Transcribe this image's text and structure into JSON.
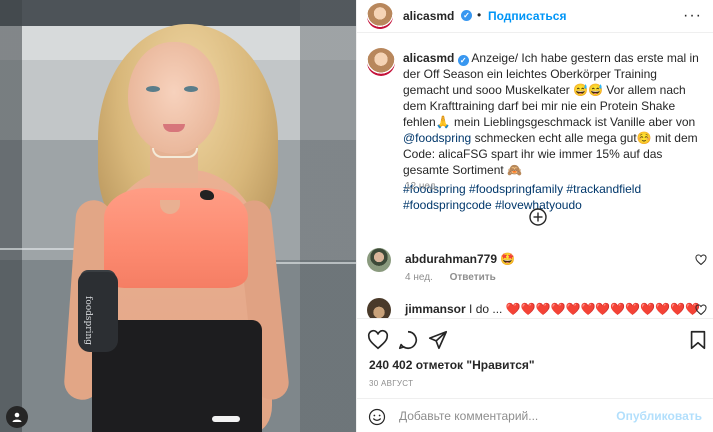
{
  "post": {
    "author": "alicasmd",
    "separator": "•",
    "follow_label": "Подписаться",
    "more_label": "···",
    "caption": {
      "username": "alicasmd",
      "text": "Anzeige/ Ich habe gestern das erste mal in der Off Season ein leichtes Oberkörper Training gemacht und sooo Muskelkater 😅😅 Vor allem nach dem Krafttraining darf bei mir nie ein Protein Shake fehlen🙏 mein Lieblingsgeschmack ist Vanille aber von",
      "mention": "@foodspring",
      "text_after": "schmecken echt alle mega gut☺️ mit dem Code: alicaFSG spart ihr wie immer 15% auf das gesamte Sortiment 🙈",
      "hashtags": "#foodspring #foodspringfamily #trackandfield #foodspringcode #lovewhatyoudo"
    },
    "caption_age": "12 нед.",
    "comments": [
      {
        "username": "abdurahman779",
        "text": "🤩",
        "age": "4 нед.",
        "reply_label": "Ответить"
      },
      {
        "username": "jimmansor",
        "text": "I do ...",
        "hearts": "❤️❤️❤️❤️❤️❤️❤️❤️❤️❤️❤️❤️❤️"
      }
    ],
    "likes": "240 402 отметок \"Нравится\"",
    "date": "30 АВГУСТ",
    "comment_placeholder": "Добавьте комментарий...",
    "publish_label": "Опубликовать",
    "shaker_text": "foodspring"
  },
  "colors": {
    "accent": "#0095f6",
    "verified": "#3897f0",
    "link": "#00376b",
    "muted": "#8e8e8e",
    "publish_disabled": "#b2dffc"
  },
  "icons": [
    "user-tag-icon",
    "verified-icon",
    "more-options-icon",
    "plus-circle-icon",
    "heart-icon",
    "comment-icon",
    "share-icon",
    "bookmark-icon",
    "emoji-icon"
  ]
}
